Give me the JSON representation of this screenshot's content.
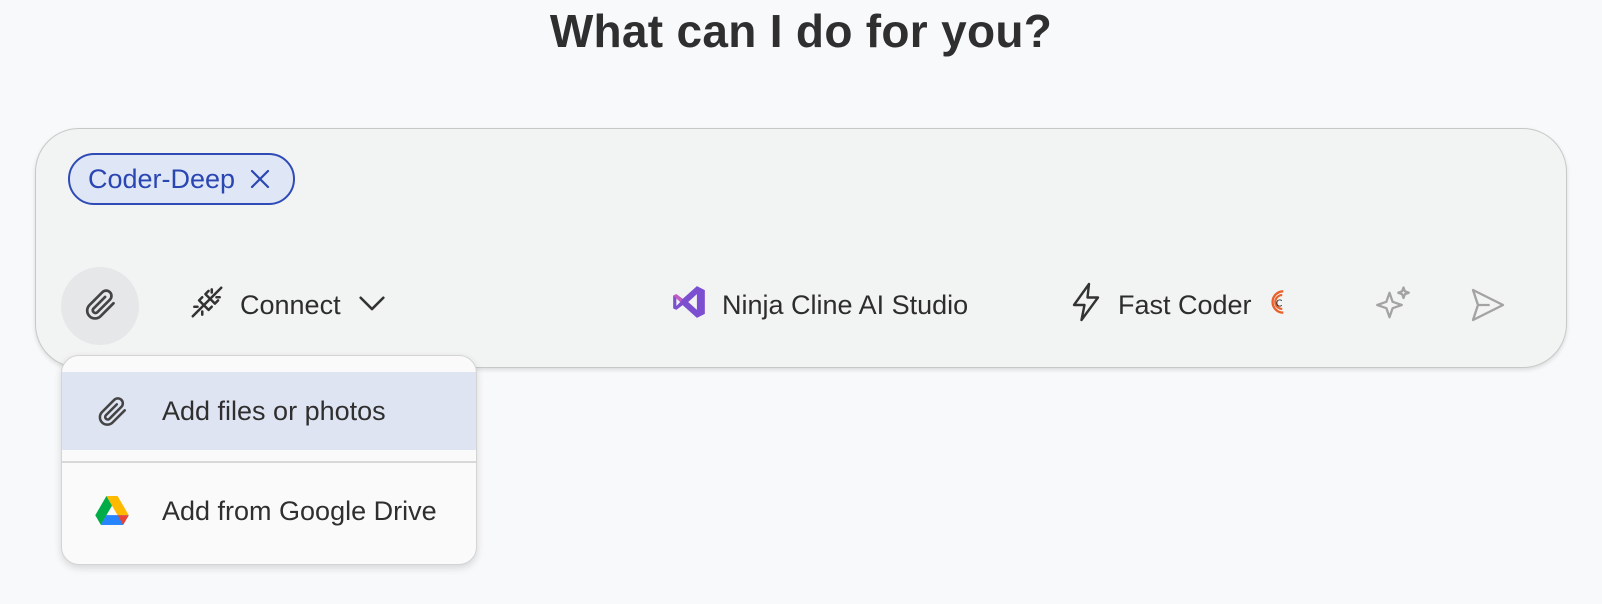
{
  "heading": "What can I do for you?",
  "chip": {
    "label": "Coder-Deep",
    "remove_icon": "close-icon"
  },
  "toolbar": {
    "attach_icon": "paperclip-icon",
    "connect_label": "Connect",
    "connect_icon": "plug-disconnected-icon",
    "ninja_label": "Ninja Cline AI Studio",
    "ninja_icon": "visual-studio-logo",
    "fast_label": "Fast Coder",
    "fast_icon": "lightning-icon",
    "sparkle_icon": "sparkle-icon",
    "send_icon": "send-icon"
  },
  "menu": {
    "items": [
      {
        "label": "Add files or photos",
        "icon": "paperclip-icon"
      },
      {
        "label": "Add from Google Drive",
        "icon": "google-drive-icon"
      }
    ]
  },
  "colors": {
    "chip_border": "#2f4bb5",
    "chip_fill": "#dfe6f6",
    "menu_highlight": "#dfe4f3",
    "ninja_purple": "#7b4fd0",
    "fast_badge": "#e8602c"
  }
}
